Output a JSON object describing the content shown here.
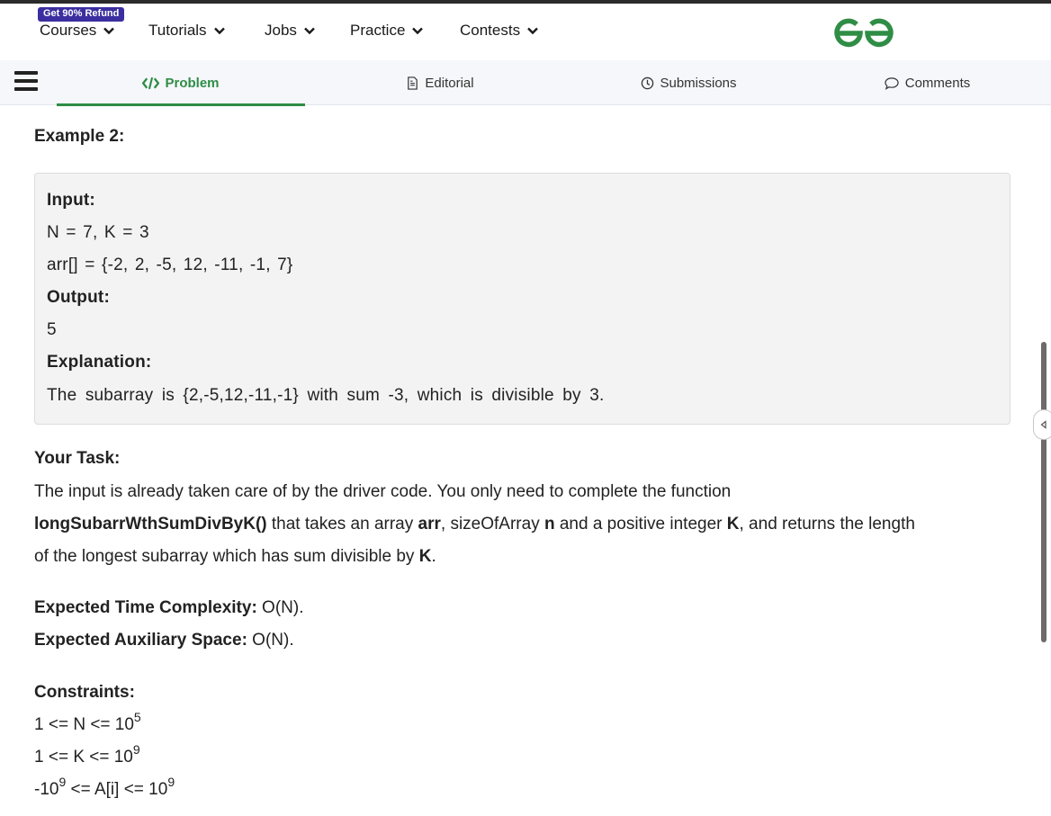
{
  "navbar": {
    "refund_badge": "Get 90% Refund",
    "items": [
      {
        "label": "Courses"
      },
      {
        "label": "Tutorials"
      },
      {
        "label": "Jobs"
      },
      {
        "label": "Practice"
      },
      {
        "label": "Contests"
      }
    ],
    "logo_icon": "gfg-logo-icon",
    "brand_color": "#2f8d46"
  },
  "tabs": [
    {
      "label": "Problem",
      "icon": "code-icon",
      "active": true
    },
    {
      "label": "Editorial",
      "icon": "document-icon",
      "active": false
    },
    {
      "label": "Submissions",
      "icon": "clock-icon",
      "active": false
    },
    {
      "label": "Comments",
      "icon": "comment-icon",
      "active": false
    }
  ],
  "example": {
    "title": "Example 2:",
    "input_label": "Input:",
    "input_line1": "N = 7, K = 3",
    "input_line2": "arr[] = {-2, 2, -5, 12, -11, -1, 7}",
    "output_label": "Output:",
    "output_value": "5",
    "explanation_label": "Explanation:",
    "explanation_text": "The subarray is {2,-5,12,-11,-1} with sum -3, which is divisible by 3."
  },
  "task": {
    "title": "Your Task:",
    "text1": "The input is already taken care of by the driver code. You only need to complete the function",
    "function_name": "longSubarrWthSumDivByK()",
    "text2": " that takes an array ",
    "arr": "arr",
    "text3": ", sizeOfArray ",
    "n": "n",
    "text4": " and a  positive integer ",
    "k": "K",
    "text5": ", and returns the length",
    "text6": "of the longest subarray which has sum divisible by ",
    "k2": "K",
    "text7": "."
  },
  "complexity": {
    "time_label": "Expected Time Complexity:",
    "time_value": " O(N).",
    "space_label": "Expected Auxiliary Space:",
    "space_value": " O(N)."
  },
  "constraints": {
    "title": "Constraints:",
    "c1_text": "1 <= N <= 10",
    "c1_exp": "5",
    "c2_text": "1 <= K <= 10",
    "c2_exp": "9",
    "c3_pre": "-10",
    "c3_exp1": "9",
    "c3_mid": " <= A[i] <= 10",
    "c3_exp2": "9"
  }
}
